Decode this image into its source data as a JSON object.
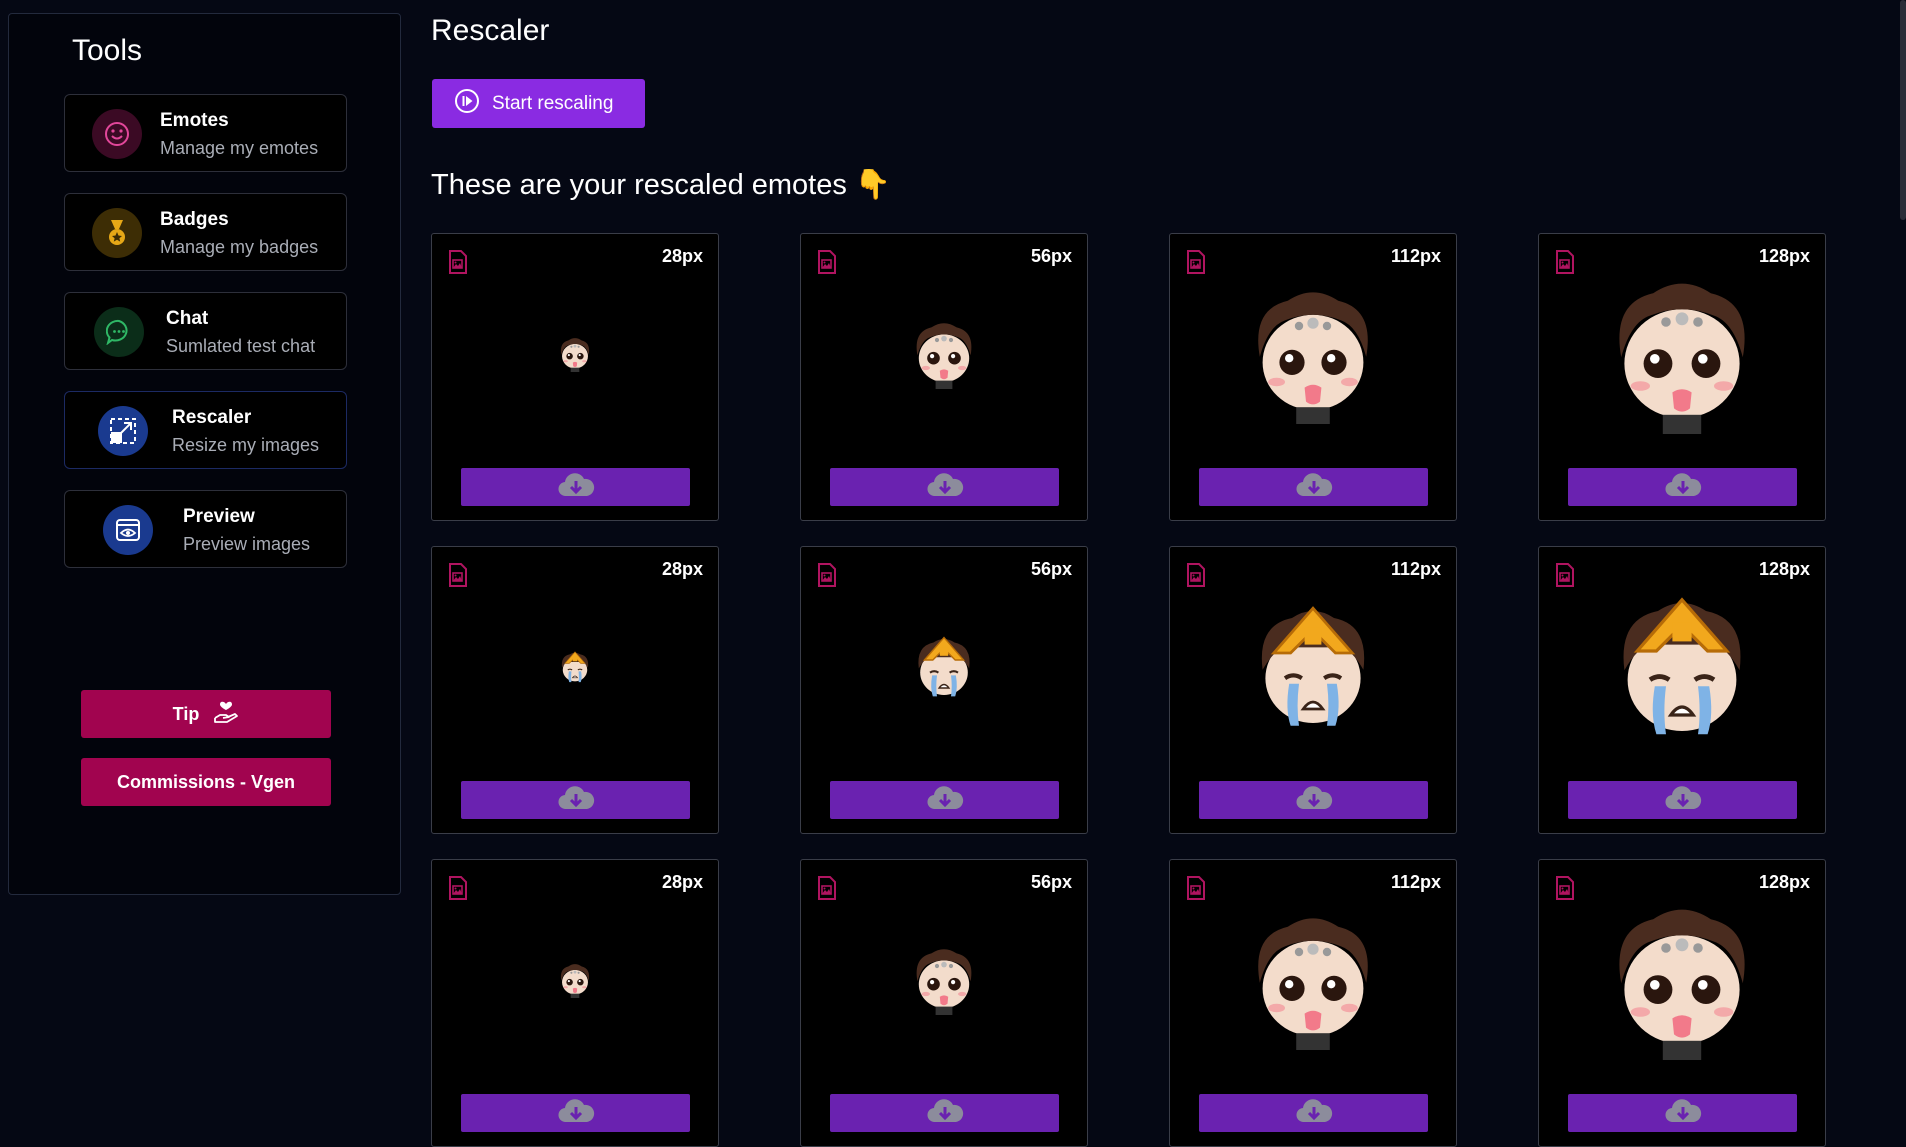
{
  "sidebar": {
    "title": "Tools",
    "items": [
      {
        "title": "Emotes",
        "subtitle": "Manage my emotes",
        "icon": "smiley-icon",
        "color": "#e2479a"
      },
      {
        "title": "Badges",
        "subtitle": "Manage my badges",
        "icon": "medal-icon",
        "color": "#e6a817"
      },
      {
        "title": "Chat",
        "subtitle": "Sumlated test chat",
        "icon": "chat-bubble-icon",
        "color": "#2fb866"
      },
      {
        "title": "Rescaler",
        "subtitle": "Resize my images",
        "icon": "resize-icon",
        "color": "#ffffff"
      },
      {
        "title": "Preview",
        "subtitle": "Preview images",
        "icon": "eye-window-icon",
        "color": "#ffffff"
      }
    ],
    "tip_label": "Tip",
    "commissions_label": "Commissions - Vgen"
  },
  "main": {
    "title": "Rescaler",
    "start_button_label": "Start rescaling",
    "section_title": "These are your rescaled emotes 👇",
    "sizes": [
      "28px",
      "56px",
      "112px",
      "128px"
    ]
  },
  "colors": {
    "accent_purple": "#8a2be2",
    "download_purple": "#6a22b0",
    "pink": "#a1044f",
    "background": "#050814"
  }
}
